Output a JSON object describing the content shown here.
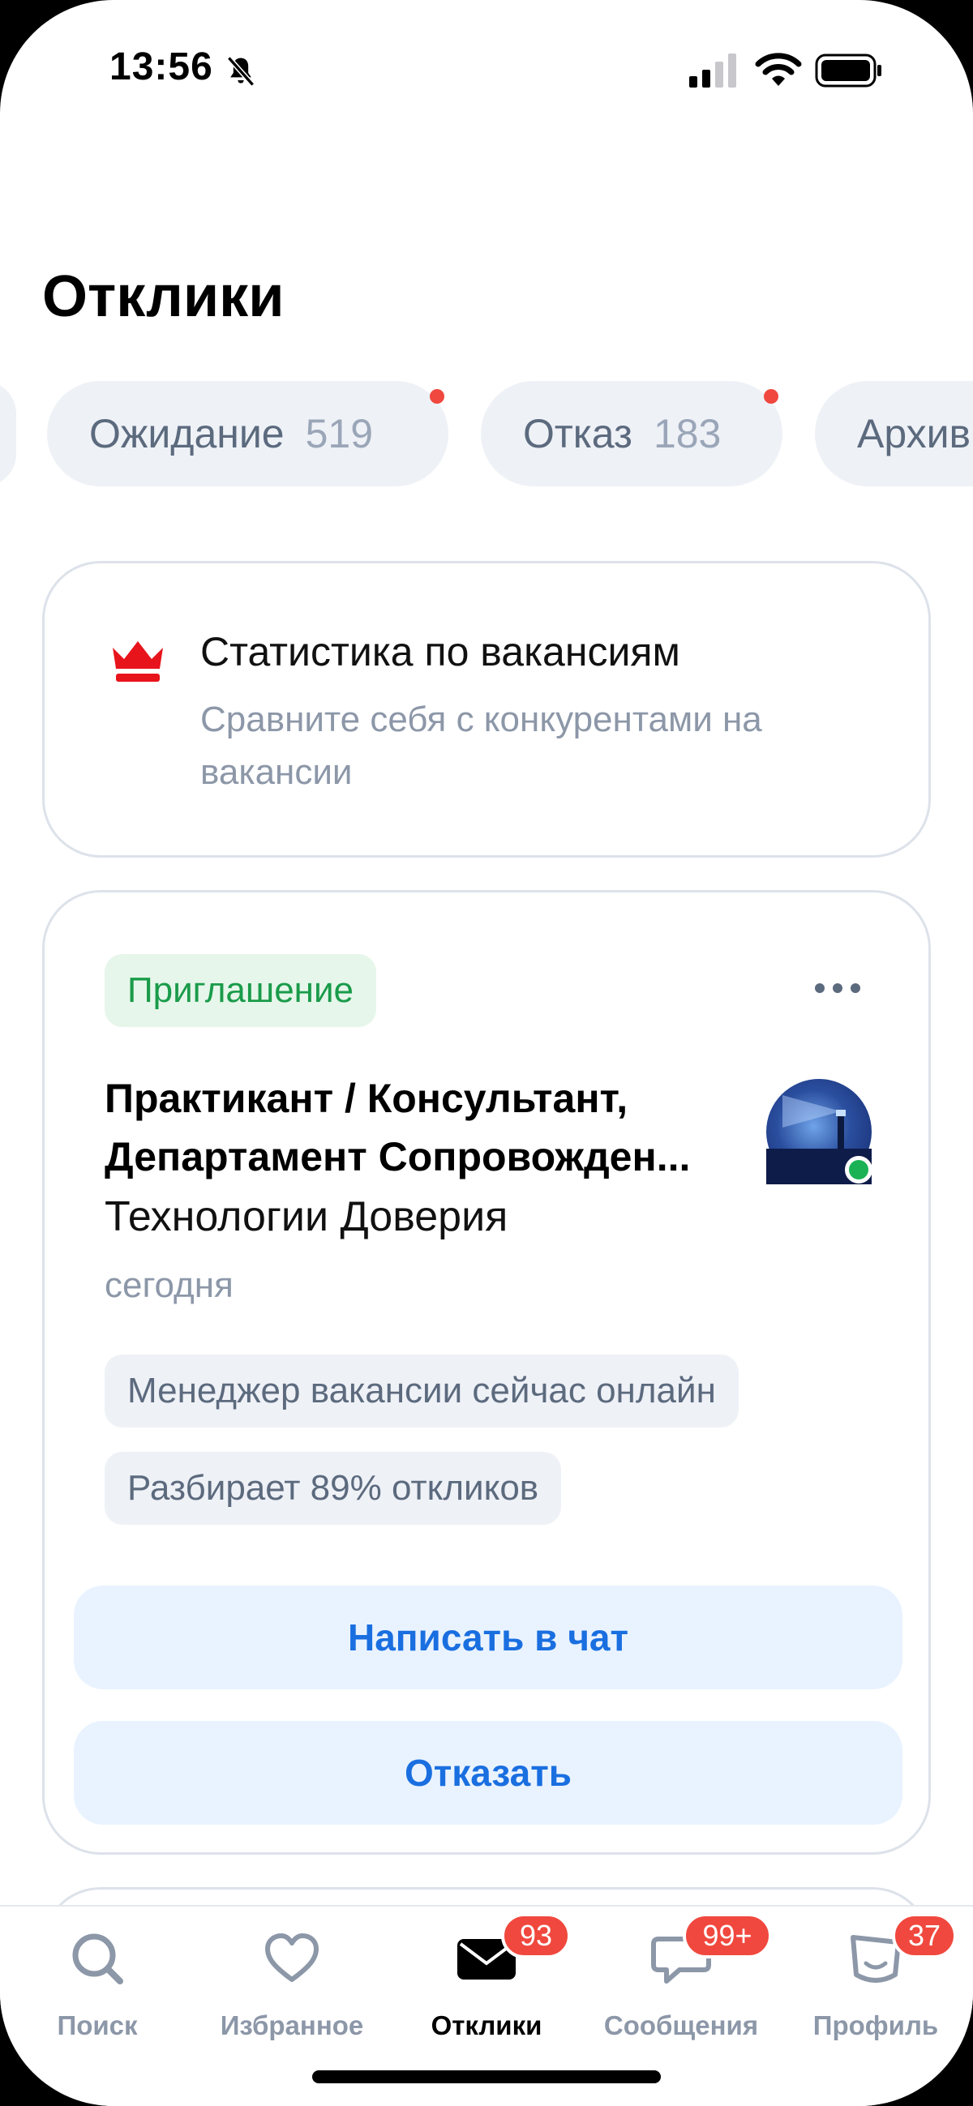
{
  "status_bar": {
    "time": "13:56"
  },
  "header": {
    "title": "Отклики"
  },
  "filters": [
    {
      "label": "Ожидание",
      "count": "519"
    },
    {
      "label": "Отказ",
      "count": "183"
    },
    {
      "label": "Архив"
    }
  ],
  "stats_banner": {
    "title": "Статистика по вакансиям",
    "subtitle": "Сравните себя с конкурентами на вакансии"
  },
  "vacancy": {
    "status": "Приглашение",
    "title": "Практикант / Консультант, Департамент Сопровожден...",
    "company": "Технологии Доверия",
    "date": "сегодня",
    "tags": [
      "Менеджер вакансии сейчас онлайн",
      "Разбирает 89% откликов"
    ],
    "chat_button": "Написать в чат",
    "reject_button": "Отказать"
  },
  "tabbar": {
    "items": [
      {
        "label": "Поиск"
      },
      {
        "label": "Избранное"
      },
      {
        "label": "Отклики",
        "badge": "93"
      },
      {
        "label": "Сообщения",
        "badge": "99+"
      },
      {
        "label": "Профиль",
        "badge": "37"
      }
    ]
  },
  "colors": {
    "accent_blue": "#1a6fe0",
    "badge_red": "#f0483e",
    "invite_green": "#1a9b4a",
    "online_green": "#1ab255"
  }
}
